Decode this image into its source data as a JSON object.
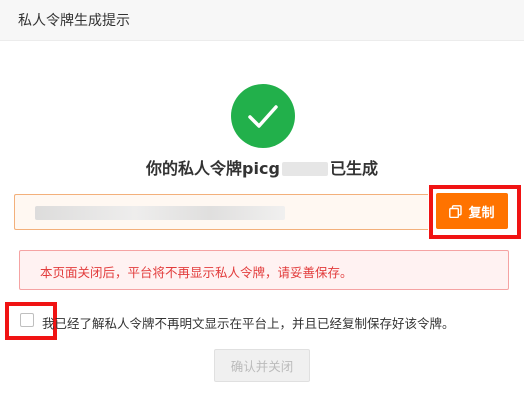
{
  "dialog": {
    "title": "私人令牌生成提示"
  },
  "result": {
    "headline_prefix": "你的私人令牌picg",
    "headline_suffix": "已生成",
    "success_color": "#22b04b",
    "success_icon": "checkmark-icon"
  },
  "token": {
    "value_obscured": true
  },
  "actions": {
    "copy_label": "复制",
    "copy_icon": "copy-icon",
    "copy_color": "#ff7300",
    "confirm_label": "确认并关闭",
    "confirm_enabled": false
  },
  "warning": {
    "text": "本页面关闭后，平台将不再显示私人令牌，请妥善保存。"
  },
  "acknowledgement": {
    "text": "我已经了解私人令牌不再明文显示在平台上，并且已经复制保存好该令牌。",
    "checked": false
  },
  "annotations": {
    "highlight_color": "#f01313"
  }
}
